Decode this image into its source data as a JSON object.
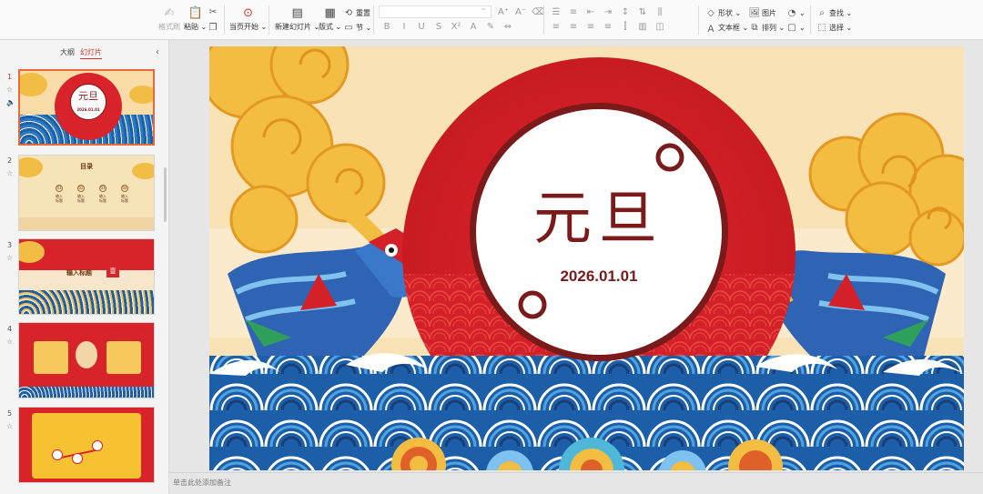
{
  "ribbon": {
    "format_painter": "格式刷",
    "paste": "粘贴",
    "from_current": "当页开始",
    "new_slide": "新建幻灯片",
    "layout": "版式",
    "reset": "重置",
    "section": "节",
    "shape": "形状",
    "picture": "图片",
    "textbox": "文本框",
    "arrange": "排列",
    "find": "查找",
    "select": "选择"
  },
  "panel": {
    "tab_outline": "大纲",
    "tab_slides": "幻灯片",
    "slides": [
      {
        "num": "1",
        "title": "元旦",
        "date": "2026.01.01"
      },
      {
        "num": "2",
        "title": "目录",
        "items": [
          "输入标题",
          "输入标题",
          "输入标题",
          "输入标题"
        ],
        "nums": [
          "01",
          "02",
          "03",
          "04"
        ]
      },
      {
        "num": "3",
        "title": "输入标题",
        "stamp": "壹"
      },
      {
        "num": "4"
      },
      {
        "num": "5"
      }
    ]
  },
  "slide": {
    "title": "元旦",
    "date": "2026.01.01"
  },
  "notes": {
    "placeholder": "单击此处添加备注"
  },
  "colors": {
    "red": "#d9232a",
    "dark_red": "#7a1a1a",
    "gold": "#f1bd45",
    "wave_blue": "#1f5fa8",
    "sky": "#f8deb0",
    "accent": "#d0342c"
  }
}
